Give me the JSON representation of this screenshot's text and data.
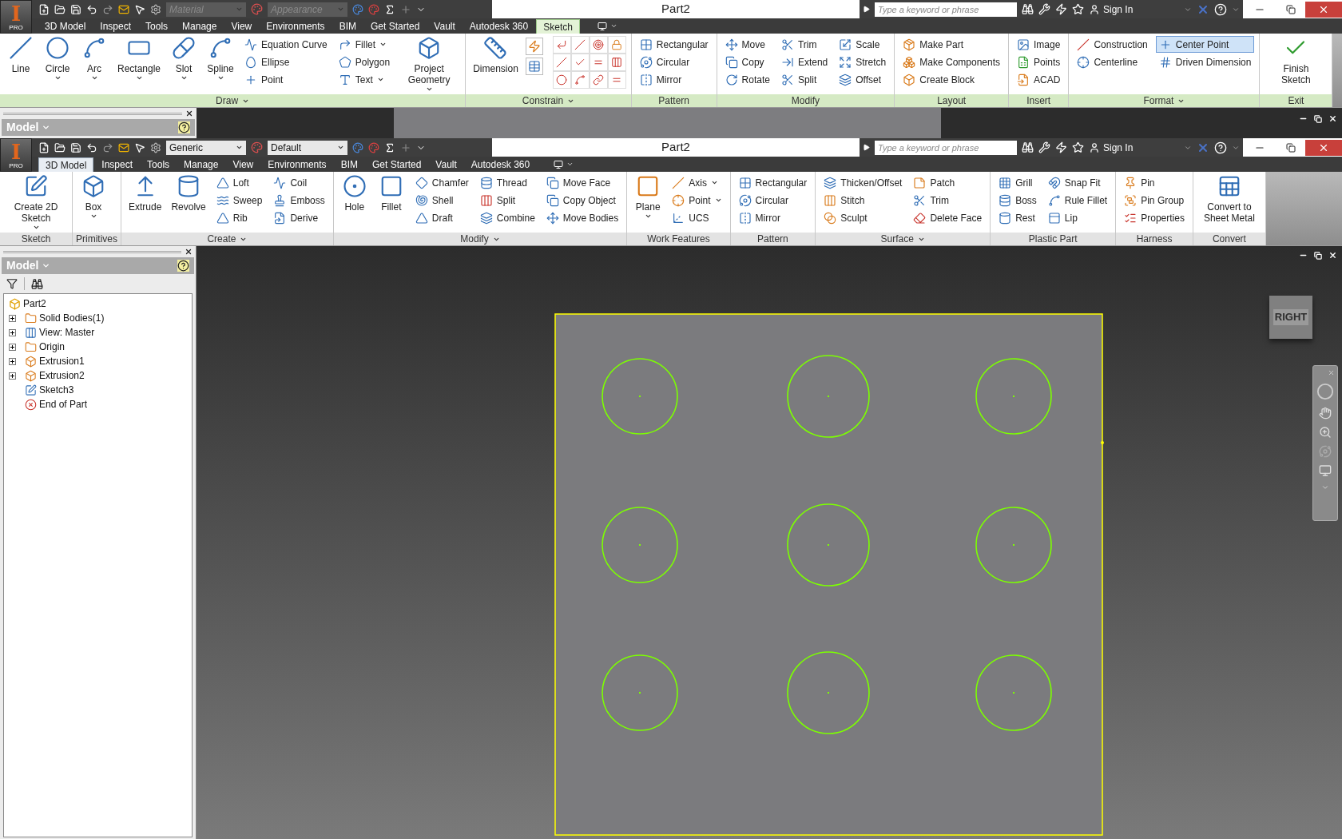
{
  "windows": [
    {
      "logo": {
        "letter": "I",
        "badge": "PRO"
      },
      "material": {
        "value": "Material",
        "disabled": true
      },
      "appearance": {
        "value": "Appearance",
        "disabled": true
      },
      "title": "Part2",
      "search": {
        "placeholder": "Type a keyword or phrase"
      },
      "sign_in": "Sign In",
      "tabs": [
        {
          "label": "3D Model",
          "selected": false
        },
        {
          "label": "Inspect",
          "selected": false
        },
        {
          "label": "Tools",
          "selected": false
        },
        {
          "label": "Manage",
          "selected": false
        },
        {
          "label": "View",
          "selected": false
        },
        {
          "label": "Environments",
          "selected": false
        },
        {
          "label": "BIM",
          "selected": false
        },
        {
          "label": "Get Started",
          "selected": false
        },
        {
          "label": "Vault",
          "selected": false
        },
        {
          "label": "Autodesk 360",
          "selected": false
        },
        {
          "label": "Sketch",
          "selected": true
        }
      ],
      "panels": [
        {
          "title": "Draw",
          "menu": true,
          "columns": [
            {
              "kind": "large",
              "label": "Line",
              "caret": false
            },
            {
              "kind": "large",
              "label": "Circle",
              "caret": true
            },
            {
              "kind": "large",
              "label": "Arc",
              "caret": true
            },
            {
              "kind": "large",
              "label": "Rectangle",
              "caret": true
            },
            {
              "kind": "large",
              "label": "Slot",
              "caret": true
            },
            {
              "kind": "large",
              "label": "Spline",
              "caret": true
            },
            {
              "kind": "stack",
              "items": [
                {
                  "label": "Equation Curve",
                  "caret": false
                },
                {
                  "label": "Ellipse",
                  "caret": false
                },
                {
                  "label": "Point",
                  "caret": false
                }
              ]
            },
            {
              "kind": "stack",
              "items": [
                {
                  "label": "Fillet",
                  "caret": true
                },
                {
                  "label": "Polygon",
                  "caret": false
                },
                {
                  "label": "Text",
                  "caret": true
                }
              ]
            },
            {
              "kind": "large",
              "label": "Project Geometry",
              "caret": true
            }
          ]
        },
        {
          "title": "Constrain",
          "menu": true,
          "columns": [
            {
              "kind": "large",
              "label": "Dimension",
              "caret": false
            },
            {
              "kind": "icon-pair"
            },
            {
              "kind": "icon-grid"
            }
          ]
        },
        {
          "title": "Pattern",
          "menu": false,
          "columns": [
            {
              "kind": "stack",
              "items": [
                {
                  "label": "Rectangular",
                  "caret": false
                },
                {
                  "label": "Circular",
                  "caret": false
                },
                {
                  "label": "Mirror",
                  "caret": false
                }
              ]
            }
          ]
        },
        {
          "title": "Modify",
          "menu": false,
          "columns": [
            {
              "kind": "stack",
              "items": [
                {
                  "label": "Move",
                  "caret": false
                },
                {
                  "label": "Copy",
                  "caret": false
                },
                {
                  "label": "Rotate",
                  "caret": false
                }
              ]
            },
            {
              "kind": "stack",
              "items": [
                {
                  "label": "Trim",
                  "caret": false
                },
                {
                  "label": "Extend",
                  "caret": false
                },
                {
                  "label": "Split",
                  "caret": false
                }
              ]
            },
            {
              "kind": "stack",
              "items": [
                {
                  "label": "Scale",
                  "caret": false
                },
                {
                  "label": "Stretch",
                  "caret": false
                },
                {
                  "label": "Offset",
                  "caret": false
                }
              ]
            }
          ]
        },
        {
          "title": "Layout",
          "menu": false,
          "columns": [
            {
              "kind": "stack",
              "items": [
                {
                  "label": "Make Part",
                  "caret": false
                },
                {
                  "label": "Make Components",
                  "caret": false
                },
                {
                  "label": "Create Block",
                  "caret": false
                }
              ]
            }
          ]
        },
        {
          "title": "Insert",
          "menu": false,
          "columns": [
            {
              "kind": "stack",
              "items": [
                {
                  "label": "Image",
                  "caret": false
                },
                {
                  "label": "Points",
                  "caret": false
                },
                {
                  "label": "ACAD",
                  "caret": false
                }
              ]
            }
          ]
        },
        {
          "title": "Format",
          "menu": true,
          "columns": [
            {
              "kind": "stack",
              "items": [
                {
                  "label": "Construction",
                  "caret": false,
                  "on": false
                },
                {
                  "label": "Centerline",
                  "caret": false,
                  "on": false
                }
              ]
            },
            {
              "kind": "stack",
              "items": [
                {
                  "label": "Center Point",
                  "caret": false,
                  "on": true
                },
                {
                  "label": "Driven Dimension",
                  "caret": false,
                  "on": false
                }
              ]
            }
          ]
        },
        {
          "title": "Exit",
          "menu": false,
          "columns": [
            {
              "kind": "large",
              "label": "Finish Sketch",
              "caret": false
            }
          ]
        }
      ]
    },
    {
      "logo": {
        "letter": "I",
        "badge": "PRO"
      },
      "material": {
        "value": "Generic",
        "disabled": false
      },
      "appearance": {
        "value": "Default",
        "disabled": false
      },
      "title": "Part2",
      "search": {
        "placeholder": "Type a keyword or phrase"
      },
      "sign_in": "Sign In",
      "tabs": [
        {
          "label": "3D Model",
          "selected": true
        },
        {
          "label": "Inspect",
          "selected": false
        },
        {
          "label": "Tools",
          "selected": false
        },
        {
          "label": "Manage",
          "selected": false
        },
        {
          "label": "View",
          "selected": false
        },
        {
          "label": "Environments",
          "selected": false
        },
        {
          "label": "BIM",
          "selected": false
        },
        {
          "label": "Get Started",
          "selected": false
        },
        {
          "label": "Vault",
          "selected": false
        },
        {
          "label": "Autodesk 360",
          "selected": false
        }
      ],
      "panels": [
        {
          "title": "Sketch",
          "menu": false,
          "columns": [
            {
              "kind": "large",
              "label": "Create 2D Sketch",
              "caret": true
            }
          ]
        },
        {
          "title": "Primitives",
          "menu": false,
          "columns": [
            {
              "kind": "large",
              "label": "Box",
              "caret": true
            }
          ]
        },
        {
          "title": "Create",
          "menu": true,
          "columns": [
            {
              "kind": "large",
              "label": "Extrude",
              "caret": false
            },
            {
              "kind": "large",
              "label": "Revolve",
              "caret": false
            },
            {
              "kind": "stack",
              "items": [
                {
                  "label": "Loft",
                  "caret": false
                },
                {
                  "label": "Sweep",
                  "caret": false
                },
                {
                  "label": "Rib",
                  "caret": false
                }
              ]
            },
            {
              "kind": "stack",
              "items": [
                {
                  "label": "Coil",
                  "caret": false
                },
                {
                  "label": "Emboss",
                  "caret": false
                },
                {
                  "label": "Derive",
                  "caret": false
                }
              ]
            }
          ]
        },
        {
          "title": "Modify",
          "menu": true,
          "columns": [
            {
              "kind": "large",
              "label": "Hole",
              "caret": false
            },
            {
              "kind": "large",
              "label": "Fillet",
              "caret": false
            },
            {
              "kind": "stack",
              "items": [
                {
                  "label": "Chamfer",
                  "caret": false
                },
                {
                  "label": "Shell",
                  "caret": false
                },
                {
                  "label": "Draft",
                  "caret": false
                }
              ]
            },
            {
              "kind": "stack",
              "items": [
                {
                  "label": "Thread",
                  "caret": false
                },
                {
                  "label": "Split",
                  "caret": false
                },
                {
                  "label": "Combine",
                  "caret": false
                }
              ]
            },
            {
              "kind": "stack",
              "items": [
                {
                  "label": "Move Face",
                  "caret": false
                },
                {
                  "label": "Copy Object",
                  "caret": false
                },
                {
                  "label": "Move Bodies",
                  "caret": false
                }
              ]
            }
          ]
        },
        {
          "title": "Work Features",
          "menu": false,
          "columns": [
            {
              "kind": "large",
              "label": "Plane",
              "caret": true
            },
            {
              "kind": "stack",
              "items": [
                {
                  "label": "Axis",
                  "caret": true
                },
                {
                  "label": "Point",
                  "caret": true
                },
                {
                  "label": "UCS",
                  "caret": false
                }
              ]
            }
          ]
        },
        {
          "title": "Pattern",
          "menu": false,
          "columns": [
            {
              "kind": "stack",
              "items": [
                {
                  "label": "Rectangular",
                  "caret": false
                },
                {
                  "label": "Circular",
                  "caret": false
                },
                {
                  "label": "Mirror",
                  "caret": false
                }
              ]
            }
          ]
        },
        {
          "title": "Surface",
          "menu": true,
          "columns": [
            {
              "kind": "stack",
              "items": [
                {
                  "label": "Thicken/Offset",
                  "caret": false
                },
                {
                  "label": "Stitch",
                  "caret": false
                },
                {
                  "label": "Sculpt",
                  "caret": false
                }
              ]
            },
            {
              "kind": "stack",
              "items": [
                {
                  "label": "Patch",
                  "caret": false
                },
                {
                  "label": "Trim",
                  "caret": false
                },
                {
                  "label": "Delete Face",
                  "caret": false
                }
              ]
            }
          ]
        },
        {
          "title": "Plastic Part",
          "menu": false,
          "columns": [
            {
              "kind": "stack",
              "items": [
                {
                  "label": "Grill",
                  "caret": false
                },
                {
                  "label": "Boss",
                  "caret": false
                },
                {
                  "label": "Rest",
                  "caret": false
                }
              ]
            },
            {
              "kind": "stack",
              "items": [
                {
                  "label": "Snap Fit",
                  "caret": false
                },
                {
                  "label": "Rule Fillet",
                  "caret": false
                },
                {
                  "label": "Lip",
                  "caret": false
                }
              ]
            }
          ]
        },
        {
          "title": "Harness",
          "menu": false,
          "columns": [
            {
              "kind": "stack",
              "items": [
                {
                  "label": "Pin",
                  "caret": false
                },
                {
                  "label": "Pin Group",
                  "caret": false
                },
                {
                  "label": "Properties",
                  "caret": false
                }
              ]
            }
          ]
        },
        {
          "title": "Convert",
          "menu": false,
          "columns": [
            {
              "kind": "large",
              "label": "Convert to Sheet Metal",
              "caret": false
            }
          ]
        }
      ]
    }
  ],
  "browser_top": {
    "title": "Model"
  },
  "browser": {
    "title": "Model",
    "tree": {
      "label": "Part2",
      "children": [
        {
          "label": "Solid Bodies(1)",
          "expanded": false
        },
        {
          "label": "View: Master",
          "expanded": false
        },
        {
          "label": "Origin",
          "expanded": false
        },
        {
          "label": "Extrusion1",
          "expanded": false
        },
        {
          "label": "Extrusion2",
          "expanded": false
        },
        {
          "label": "Sketch3"
        },
        {
          "label": "End of Part"
        }
      ]
    }
  },
  "viewcube": {
    "face": "RIGHT"
  }
}
